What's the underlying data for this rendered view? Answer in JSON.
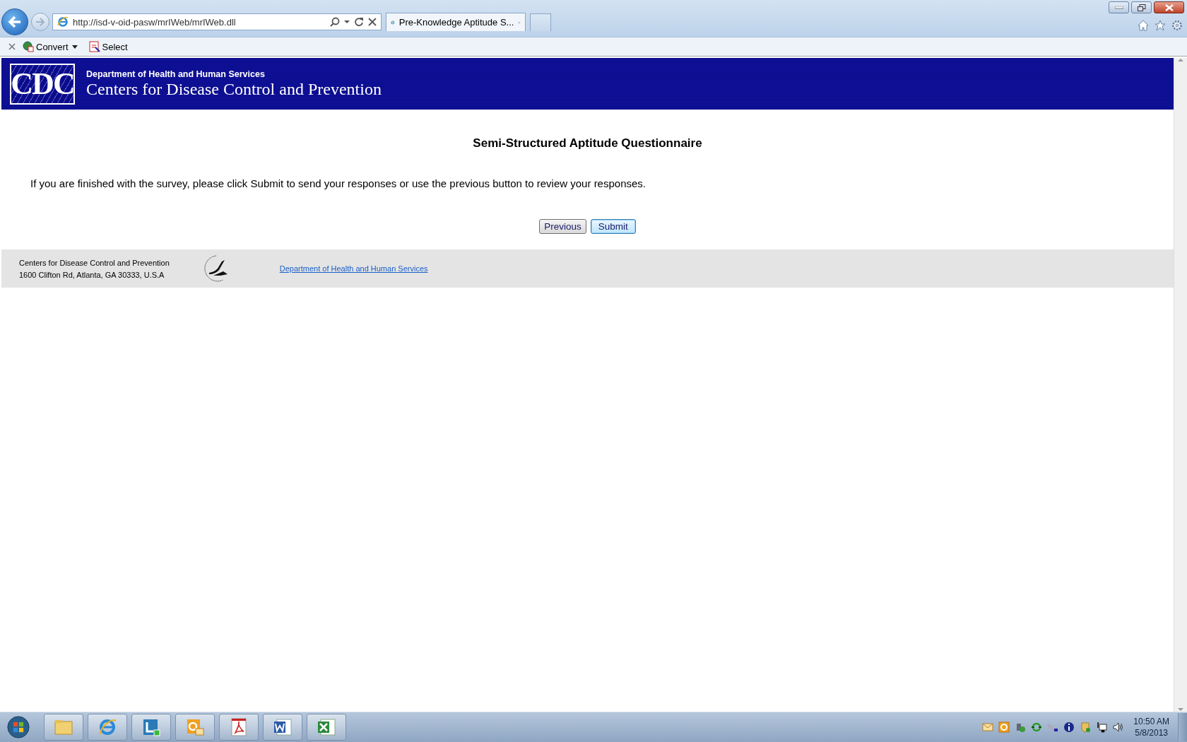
{
  "browser": {
    "address": "http://isd-v-oid-pasw/mrIWeb/mrIWeb.dll",
    "tab_title": "Pre-Knowledge Aptitude S...",
    "toolbar": [
      {
        "label": "Convert",
        "kind": "dropdown"
      },
      {
        "label": "Select",
        "kind": "button"
      }
    ]
  },
  "header": {
    "logo": "CDC",
    "agency": "Department of Health and Human Services",
    "title": "Centers for Disease Control and Prevention"
  },
  "page": {
    "title": "Semi-Structured Aptitude Questionnaire",
    "instruction": "If you are finished with the survey, please click Submit to send your responses or use the previous button to review your responses.",
    "buttons": [
      {
        "label": "Previous",
        "kind": "normal"
      },
      {
        "label": "Submit",
        "kind": "default"
      }
    ]
  },
  "footer": {
    "lines": [
      "Centers for Disease Control and Prevention",
      "1600 Clifton Rd, Atlanta, GA 30333, U.S.A"
    ],
    "link": "Department of Health and Human Services"
  },
  "taskbar": {
    "time": "10:50 AM",
    "date": "5/8/2013"
  }
}
